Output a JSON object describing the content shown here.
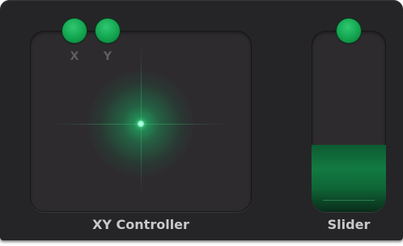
{
  "xy_controller": {
    "caption": "XY Controller",
    "x_label": "X",
    "y_label": "Y",
    "x_value": 0.5,
    "y_value": 0.5
  },
  "slider": {
    "caption": "Slider",
    "value": 0.37
  },
  "colors": {
    "accent_green": "#13a44f",
    "panel_bg": "#252527",
    "pad_bg": "#2e2b2f",
    "label_gray": "#5e5e62",
    "caption_text": "#c9c9cc"
  },
  "icons": {
    "x_knob": "green-circle-knob",
    "y_knob": "green-circle-knob",
    "slider_thumb": "green-circle-knob"
  }
}
